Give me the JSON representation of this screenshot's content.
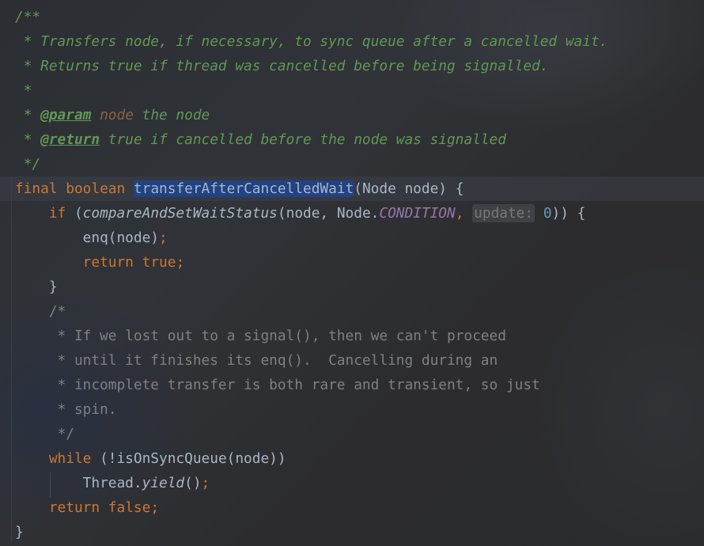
{
  "code": {
    "doc_open": "/**",
    "doc_line1": " * Transfers node, if necessary, to sync queue after a cancelled wait.",
    "doc_line2": " * Returns true if thread was cancelled before being signalled.",
    "doc_star": " *",
    "doc_param_prefix": " * ",
    "doc_param_tag": "@param",
    "doc_param_name": "node",
    "doc_param_desc": " the node",
    "doc_return_prefix": " * ",
    "doc_return_tag": "@return",
    "doc_return_desc": " true if cancelled before the node was signalled",
    "doc_close": " */",
    "sig_final": "final",
    "sig_boolean": "boolean",
    "sig_method": "transferAfterCancelledWait",
    "sig_params": "(Node node) {",
    "if_kw": "if",
    "if_open": " (",
    "cas_method": "compareAndSetWaitStatus",
    "cas_args_start": "(node, Node.",
    "cas_constant": "CONDITION",
    "cas_comma": ", ",
    "cas_hint": "update:",
    "cas_value": "0",
    "cas_close": ")) {",
    "enq_call": "enq(node)",
    "semicolon": ";",
    "return_kw": "return",
    "true_kw": "true",
    "close_brace": "}",
    "cmt_open": "/*",
    "cmt_line1": " * If we lost out to a signal(), then we can't proceed",
    "cmt_line2": " * until it finishes its enq().  Cancelling during an",
    "cmt_line3": " * incomplete transfer is both rare and transient, so just",
    "cmt_line4": " * spin.",
    "cmt_close": " */",
    "while_kw": "while",
    "while_cond": " (!isOnSyncQueue(node))",
    "thread_class": "Thread.",
    "yield_method": "yield",
    "yield_call": "()",
    "false_kw": "false"
  }
}
